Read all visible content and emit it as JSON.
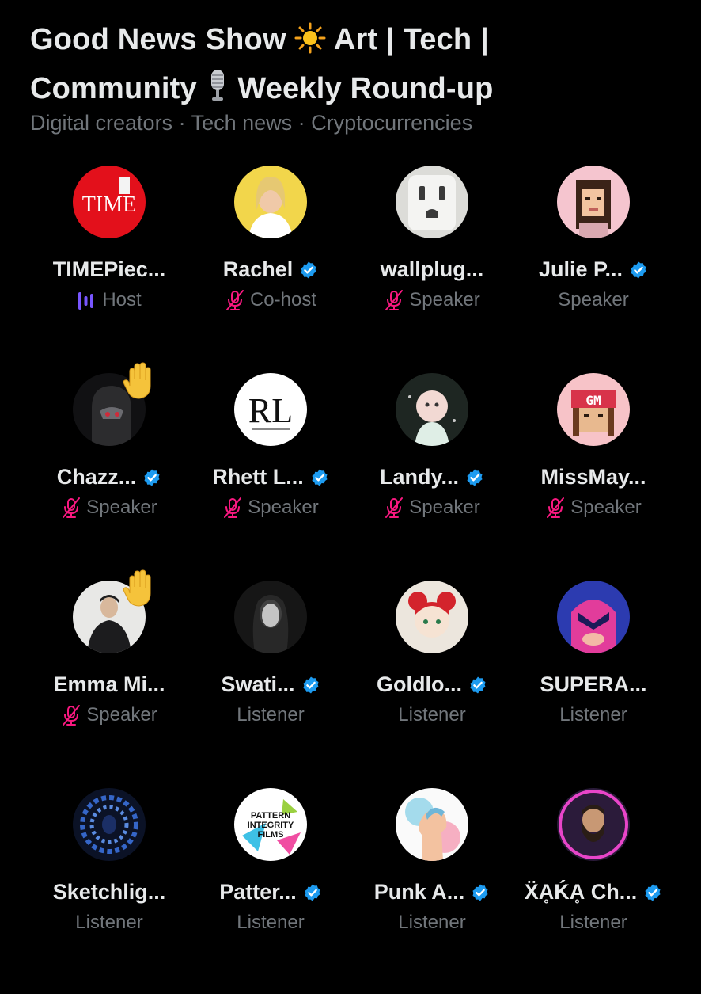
{
  "space": {
    "title_part1": "Good News Show",
    "title_part2": "Art | Tech |",
    "title_part3": "Community",
    "title_part4": "Weekly Round-up",
    "topics": "Digital creators · Tech news · Cryptocurrencies"
  },
  "colors": {
    "background": "#000000",
    "text_primary": "#e7e9ea",
    "text_secondary": "#71767b",
    "verified": "#1d9bf0",
    "host_speaking": "#7856ff",
    "muted_mic": "#f91880"
  },
  "participants": [
    {
      "name": "TIMEPiec...",
      "role": "Host",
      "verified": false,
      "role_icon": "speaking-bars-icon",
      "hand_raised": false,
      "avatar": "time-logo"
    },
    {
      "name": "Rachel",
      "role": "Co-host",
      "verified": true,
      "role_icon": "muted-mic-icon",
      "hand_raised": false,
      "avatar": "photo-woman-yellow"
    },
    {
      "name": "wallplug...",
      "role": "Speaker",
      "verified": false,
      "role_icon": "muted-mic-icon",
      "hand_raised": false,
      "avatar": "wall-outlet"
    },
    {
      "name": "Julie P...",
      "role": "Speaker",
      "verified": true,
      "role_icon": "",
      "hand_raised": false,
      "avatar": "pixel-woman"
    },
    {
      "name": "Chazz...",
      "role": "Speaker",
      "verified": true,
      "role_icon": "muted-mic-icon",
      "hand_raised": true,
      "avatar": "dark-helmet"
    },
    {
      "name": "Rhett L...",
      "role": "Speaker",
      "verified": true,
      "role_icon": "muted-mic-icon",
      "hand_raised": false,
      "avatar": "rl-monogram"
    },
    {
      "name": "Landy...",
      "role": "Speaker",
      "verified": true,
      "role_icon": "muted-mic-icon",
      "hand_raised": false,
      "avatar": "illustrated-baby"
    },
    {
      "name": "MissMay...",
      "role": "Speaker",
      "verified": false,
      "role_icon": "muted-mic-icon",
      "hand_raised": false,
      "avatar": "pixel-gm-cap"
    },
    {
      "name": "Emma Mi...",
      "role": "Speaker",
      "verified": false,
      "role_icon": "muted-mic-icon",
      "hand_raised": true,
      "avatar": "photo-man-suit"
    },
    {
      "name": "Swati...",
      "role": "Listener",
      "verified": true,
      "role_icon": "",
      "hand_raised": false,
      "avatar": "bw-portrait"
    },
    {
      "name": "Goldlo...",
      "role": "Listener",
      "verified": true,
      "role_icon": "",
      "hand_raised": false,
      "avatar": "red-hair-girl"
    },
    {
      "name": "SUPERA...",
      "role": "Listener",
      "verified": false,
      "role_icon": "",
      "hand_raised": false,
      "avatar": "masked-hero"
    },
    {
      "name": "Sketchlig...",
      "role": "Listener",
      "verified": false,
      "role_icon": "",
      "hand_raised": false,
      "avatar": "blue-swirl"
    },
    {
      "name": "Patter...",
      "role": "Listener",
      "verified": true,
      "role_icon": "",
      "hand_raised": false,
      "avatar": "pattern-integrity-films"
    },
    {
      "name": "Punk A...",
      "role": "Listener",
      "verified": true,
      "role_icon": "",
      "hand_raised": false,
      "avatar": "watercolor-profile"
    },
    {
      "name": "ẌḀḰḀ Ch...",
      "role": "Listener",
      "verified": true,
      "role_icon": "",
      "hand_raised": false,
      "avatar": "neon-bearded-man"
    }
  ],
  "logo_text": {
    "time": "TIME",
    "rl": "RL",
    "gm": "GM",
    "pattern_line1": "PATTERN",
    "pattern_line2": "INTEGRITY",
    "pattern_line3": "FILMS"
  }
}
